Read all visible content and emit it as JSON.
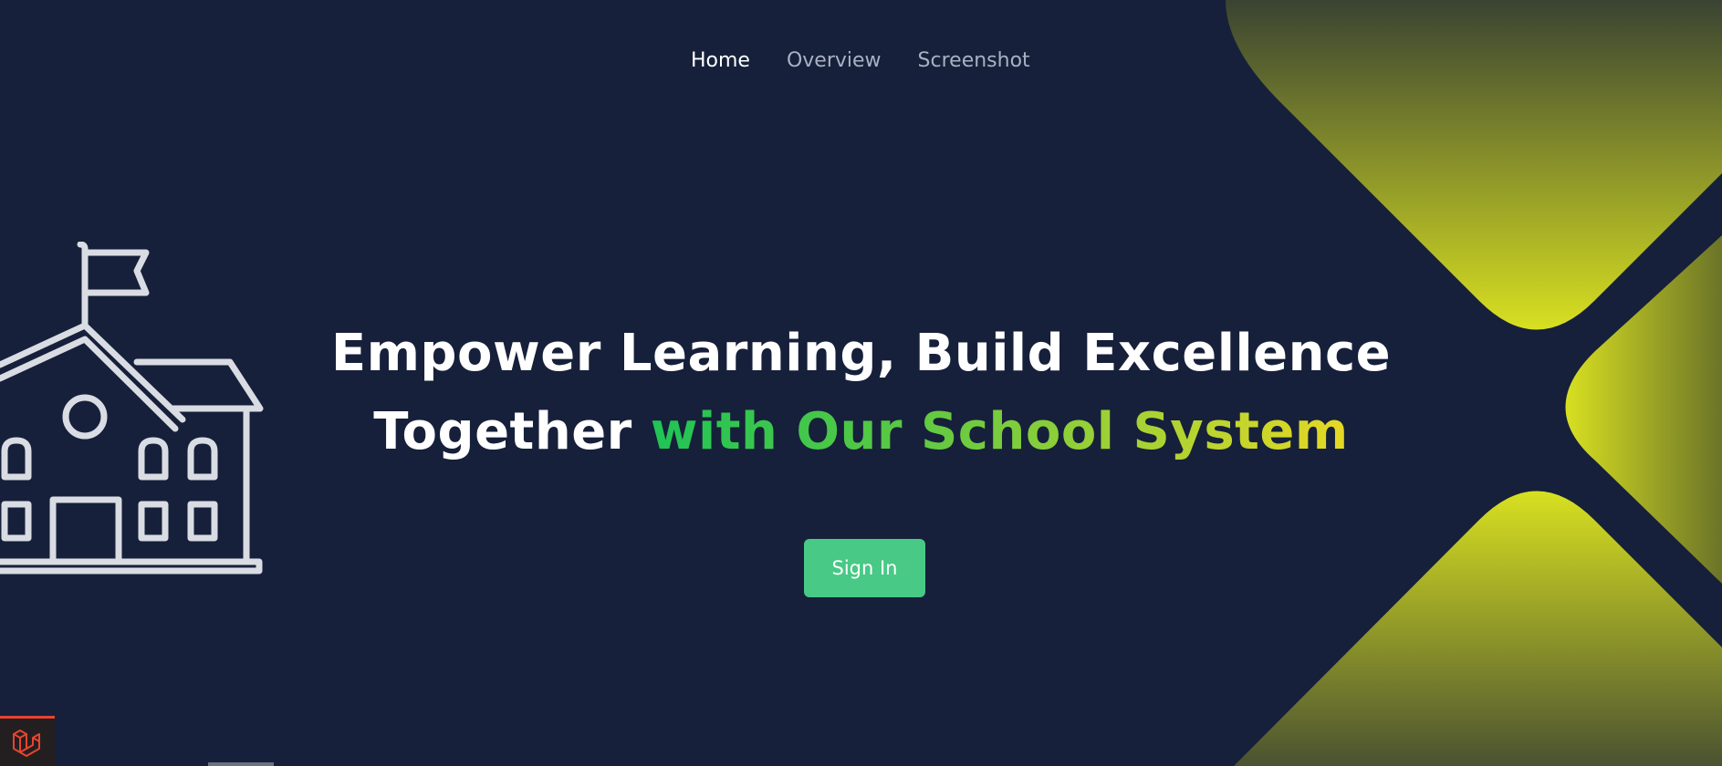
{
  "nav": {
    "items": [
      {
        "label": "Home",
        "active": true
      },
      {
        "label": "Overview",
        "active": false
      },
      {
        "label": "Screenshot",
        "active": false
      }
    ]
  },
  "hero": {
    "line1": "Empower Learning, Build Excellence",
    "line2_plain": "Together",
    "line2_gradient": "with Our School System",
    "button_label": "Sign In"
  },
  "colors": {
    "background": "#16203a",
    "accent_button": "#48c985",
    "gradient_start": "#1fc456",
    "gradient_end": "#e6d824",
    "deco_yellow": "#d6e024"
  },
  "icons": {
    "illustration": "school-building-icon",
    "badge": "laravel-logo-icon"
  }
}
